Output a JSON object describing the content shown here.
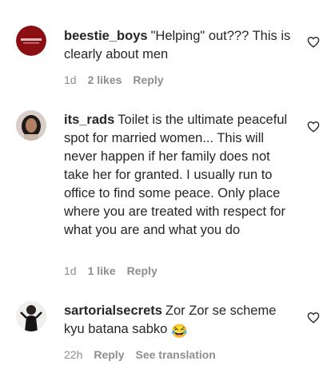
{
  "comments": [
    {
      "username": "beestie_boys",
      "text": "\"Helping\" out??? This is clearly about men",
      "time": "1d",
      "likes": "2 likes",
      "reply": "Reply",
      "avatar_icon": "red-badge-avatar",
      "avatar_color": "#8b0e12"
    },
    {
      "username": "its_rads",
      "text": "Toilet is the ultimate peaceful spot for married women... This will never happen if her family does not take her for granted. I usually run to office to find some peace. Only place where you are treated with respect for what you are and what you do",
      "time": "1d",
      "likes": "1 like",
      "reply": "Reply",
      "avatar_icon": "profile-photo-avatar"
    },
    {
      "username": "sartorialsecrets",
      "text": "Zor Zor se scheme kyu batana sabko",
      "emoji": "😂",
      "time": "22h",
      "reply": "Reply",
      "see_translation": "See translation",
      "avatar_icon": "profile-photo-avatar"
    }
  ],
  "icons": {
    "like": "heart-outline-icon"
  },
  "colors": {
    "text": "#262626",
    "meta": "#8e8e8e",
    "background": "#ffffff"
  }
}
